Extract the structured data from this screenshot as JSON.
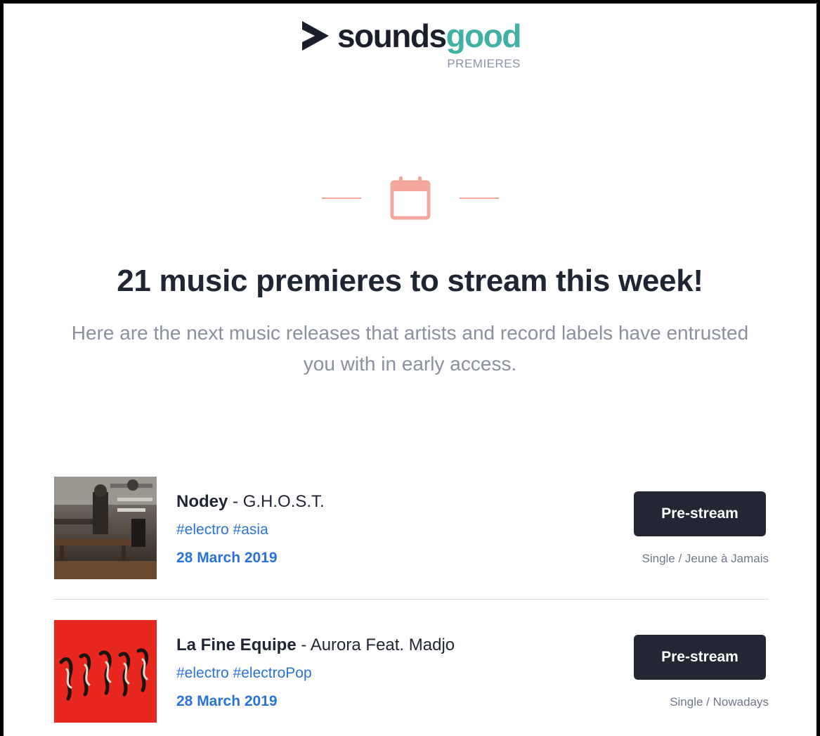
{
  "brand": {
    "name_part1": "sounds",
    "name_part2": "good",
    "subtitle": "PREMIERES",
    "colors": {
      "dark": "#1b1f2b",
      "accent": "#3fb1a5",
      "icon_accent": "#f3a79c",
      "link": "#2a73d6"
    }
  },
  "hero": {
    "icon": "calendar-icon",
    "headline": "21 music premieres to stream this week!",
    "subline": "Here are the next music releases that artists and record labels have entrusted you with in early access."
  },
  "releases": [
    {
      "artist": "Nodey",
      "separator": " - ",
      "track": "G.H.O.S.T.",
      "tags": "#electro #asia",
      "date": "28 March 2019",
      "button_label": "Pre-stream",
      "meta": "Single / Jeune à Jamais"
    },
    {
      "artist": "La Fine Equipe",
      "separator": " - ",
      "track": "Aurora Feat. Madjo",
      "tags": "#electro #electroPop",
      "date": "28 March 2019",
      "button_label": "Pre-stream",
      "meta": "Single / Nowadays"
    }
  ]
}
